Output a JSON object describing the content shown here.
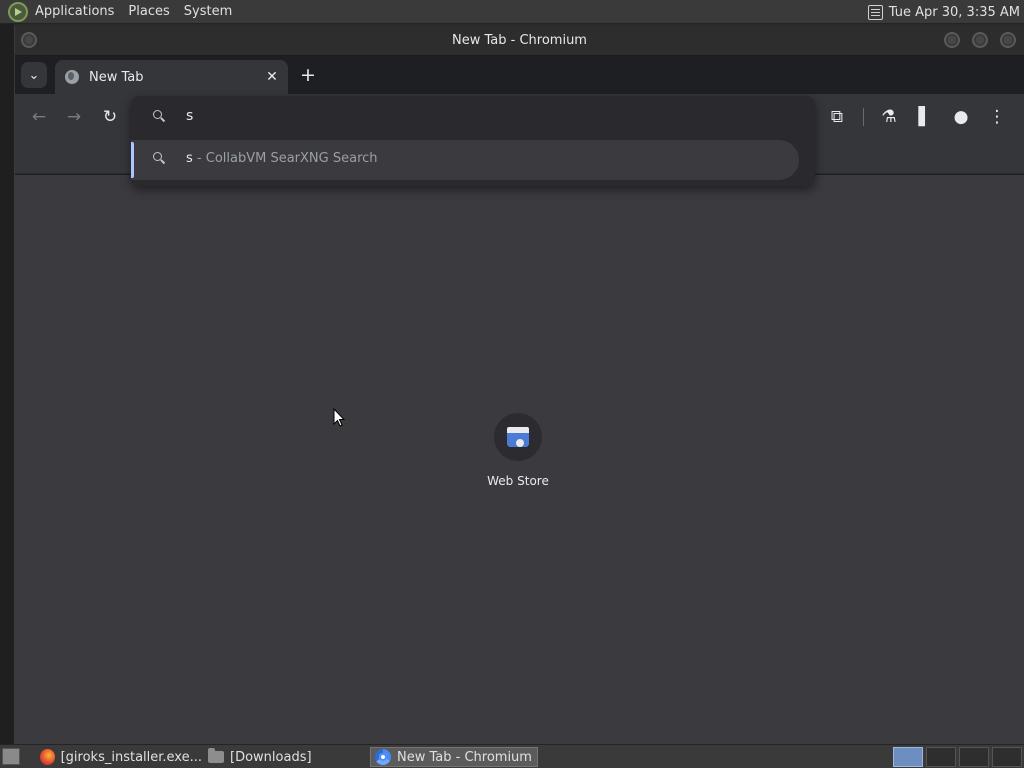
{
  "top_panel": {
    "menus": [
      "Applications",
      "Places",
      "System"
    ],
    "clock": "Tue Apr 30,  3:35 AM"
  },
  "window": {
    "title": "New Tab - Chromium"
  },
  "tabs": [
    {
      "title": "New Tab",
      "close": "✕",
      "icon": "globe-icon"
    }
  ],
  "new_tab_symbol": "+",
  "tab_search_symbol": "⌄",
  "toolbar": {
    "back": "←",
    "forward": "→",
    "reload": "↻",
    "extensions": "⧉",
    "labs": "⚗",
    "side_panel": "▌",
    "profile": "●",
    "menu": "⋮"
  },
  "omnibox": {
    "input_value": "s",
    "suggestion_query": "s",
    "suggestion_desc": " - CollabVM SearXNG Search"
  },
  "shortcuts": [
    {
      "label": "Web Store",
      "icon": "webstore-icon"
    }
  ],
  "taskbar": {
    "tasks": [
      {
        "label": "[giroks_installer.exe...",
        "icon": "firefox-icon"
      },
      {
        "label": "[Downloads]",
        "icon": "folder-icon"
      },
      {
        "label": "New Tab - Chromium",
        "icon": "chromium-icon",
        "active": true
      }
    ]
  },
  "colors": {
    "content_bg": "#3b3a3f",
    "toolbar_bg": "#35363a",
    "tabstrip_bg": "#1e1f22",
    "selection_accent": "#a8c7fa"
  }
}
